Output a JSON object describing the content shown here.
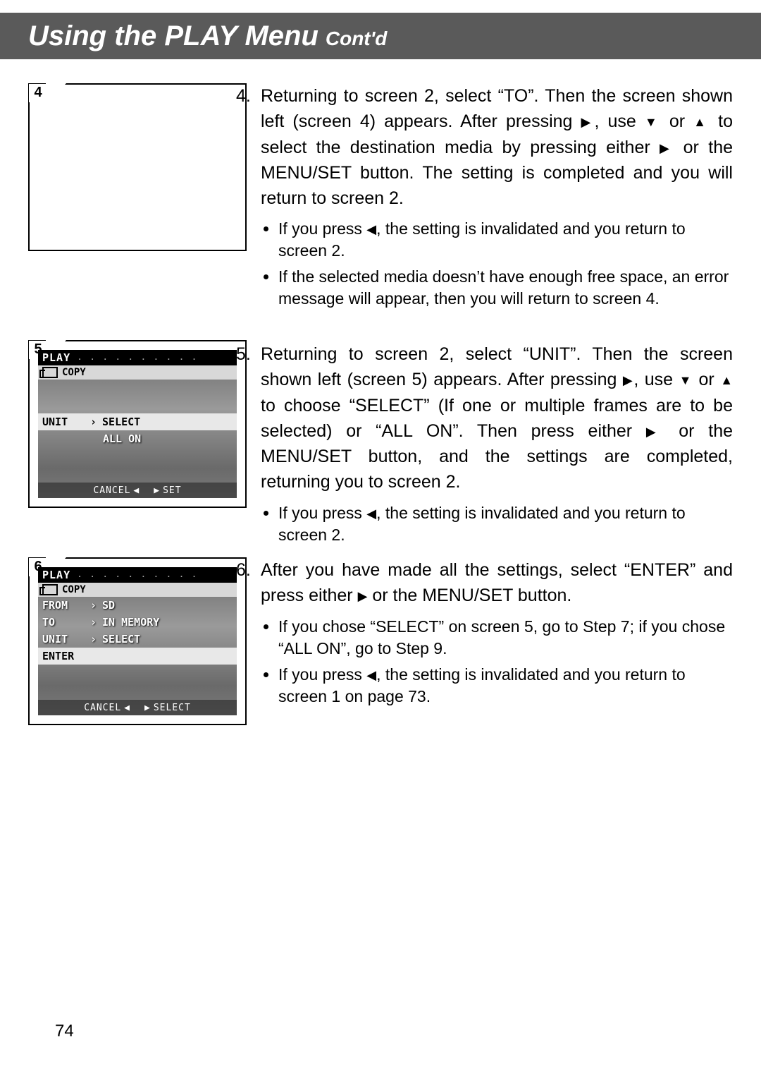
{
  "title": {
    "main": "Using the PLAY Menu",
    "sub": "Cont'd"
  },
  "page_number": "74",
  "screens": {
    "s4": {
      "label": "4"
    },
    "s5": {
      "label": "5",
      "header": "PLAY",
      "tab": "COPY",
      "row_unit": "UNIT",
      "val_select": "SELECT",
      "val_allon": "ALL ON",
      "foot_cancel": "CANCEL",
      "foot_set": "SET"
    },
    "s6": {
      "label": "6",
      "header": "PLAY",
      "tab": "COPY",
      "row_from": "FROM",
      "val_from": "SD",
      "row_to": "TO",
      "val_to": "IN MEMORY",
      "row_unit": "UNIT",
      "val_unit": "SELECT",
      "row_enter": "ENTER",
      "foot_cancel": "CANCEL",
      "foot_select": "SELECT"
    }
  },
  "steps": {
    "s4": {
      "num": "4.",
      "text_a": "Returning to screen 2, select “TO”. Then the screen shown left (screen 4) appears. After pressing ",
      "text_b": ", use ",
      "text_c": " or ",
      "text_d": " to select the destination media by pressing either ",
      "text_e": " or the MENU/SET button. The setting is completed and you will return to screen 2.",
      "b1a": "If you press ",
      "b1b": ", the setting is invalidated and you return to screen 2.",
      "b2": "If the selected media doesn’t have enough free space, an error message will appear, then you will return to screen 4."
    },
    "s5": {
      "num": "5.",
      "text_a": "Returning to screen 2, select “UNIT”. Then the screen shown left (screen 5) appears. After pressing ",
      "text_b": ", use ",
      "text_c": " or ",
      "text_d": " to choose “SELECT” (If one or multiple frames are to be selected) or “ALL ON”. Then press either ",
      "text_e": " or the MENU/SET button, and the settings are completed, returning you to screen 2.",
      "b1a": "If you press ",
      "b1b": ", the setting is invalidated and you return to screen 2."
    },
    "s6": {
      "num": "6.",
      "text_a": "After you have made all the settings, select “ENTER” and press either ",
      "text_b": " or the MENU/SET button.",
      "b1": "If you chose “SELECT” on screen 5, go to Step 7; if you chose “ALL ON”, go to Step 9.",
      "b2a": "If you press ",
      "b2b": ", the setting is invalidated and you return to screen 1 on page 73."
    }
  },
  "glyph": {
    "right": "▶",
    "left": "◀",
    "down": "▼",
    "up": "▲"
  }
}
